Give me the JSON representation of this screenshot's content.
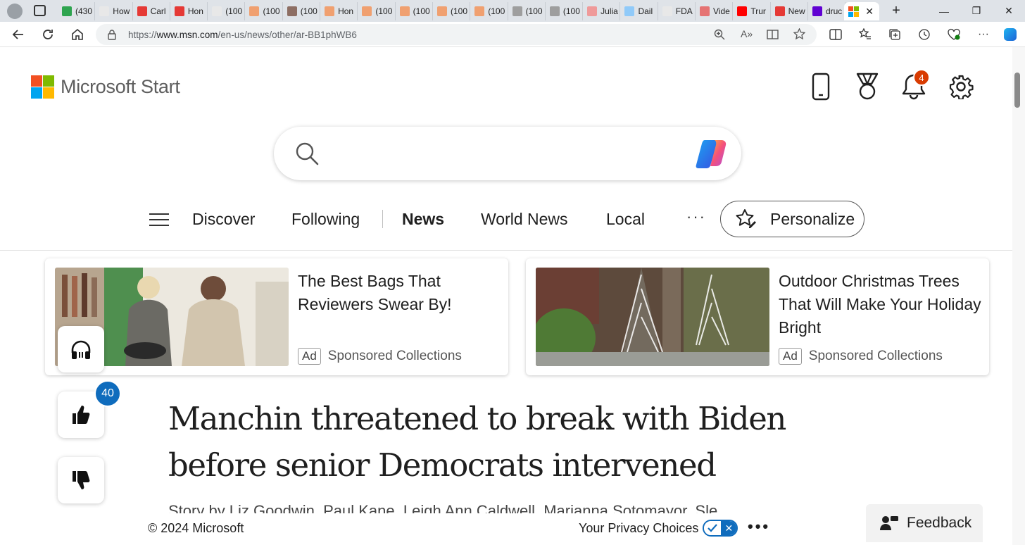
{
  "browser": {
    "tabs": [
      {
        "label": "(430",
        "color": "#2ea44f"
      },
      {
        "label": "How",
        "color": "#e8e8e8"
      },
      {
        "label": "Carl",
        "color": "#e53935"
      },
      {
        "label": "Hon",
        "color": "#e53935"
      },
      {
        "label": "(100",
        "color": "#e8e8e8"
      },
      {
        "label": "(100",
        "color": "#f0a070"
      },
      {
        "label": "(100",
        "color": "#8d6e63"
      },
      {
        "label": "Hon",
        "color": "#f0a070"
      },
      {
        "label": "(100",
        "color": "#f0a070"
      },
      {
        "label": "(100",
        "color": "#f0a070"
      },
      {
        "label": "(100",
        "color": "#f0a070"
      },
      {
        "label": "(100",
        "color": "#f0a070"
      },
      {
        "label": "(100",
        "color": "#9e9e9e"
      },
      {
        "label": "(100",
        "color": "#9e9e9e"
      },
      {
        "label": "Julia",
        "color": "#ef9a9a"
      },
      {
        "label": "Dail",
        "color": "#90caf9"
      },
      {
        "label": "FDA",
        "color": "#e8e8e8"
      },
      {
        "label": "Vide",
        "color": "#e57373"
      },
      {
        "label": "Trur",
        "color": "#ff0000"
      },
      {
        "label": "New",
        "color": "#e53935"
      },
      {
        "label": "druc",
        "color": "#6001d2"
      }
    ],
    "url_prefix": "https://",
    "url_host": "www.msn.com",
    "url_path": "/en-us/news/other/ar-BB1phWB6"
  },
  "header": {
    "logo_text": "Microsoft Start",
    "notification_count": "4"
  },
  "search": {
    "placeholder": ""
  },
  "nav": {
    "items": [
      "Discover",
      "Following",
      "News",
      "World News",
      "Local"
    ],
    "more": "···",
    "personalize": "Personalize"
  },
  "ads": [
    {
      "title": "The Best Bags That Reviewers Swear By!",
      "badge": "Ad",
      "source": "Sponsored Collections"
    },
    {
      "title": "Outdoor Christmas Trees That Will Make Your Holiday Bright",
      "badge": "Ad",
      "source": "Sponsored Collections"
    }
  ],
  "article": {
    "like_count": "40",
    "headline": "Manchin threatened to break with Biden before senior Democrats intervened",
    "byline": "Story by Liz Goodwin, Paul Kane, Leigh Ann Caldwell, Marianna Sotomayor, Sle"
  },
  "footer": {
    "copyright": "© 2024 Microsoft",
    "privacy": "Your Privacy Choices",
    "more": "•••",
    "feedback": "Feedback"
  },
  "colors": {
    "accent": "#0f6cbd",
    "notification": "#d83b01"
  }
}
